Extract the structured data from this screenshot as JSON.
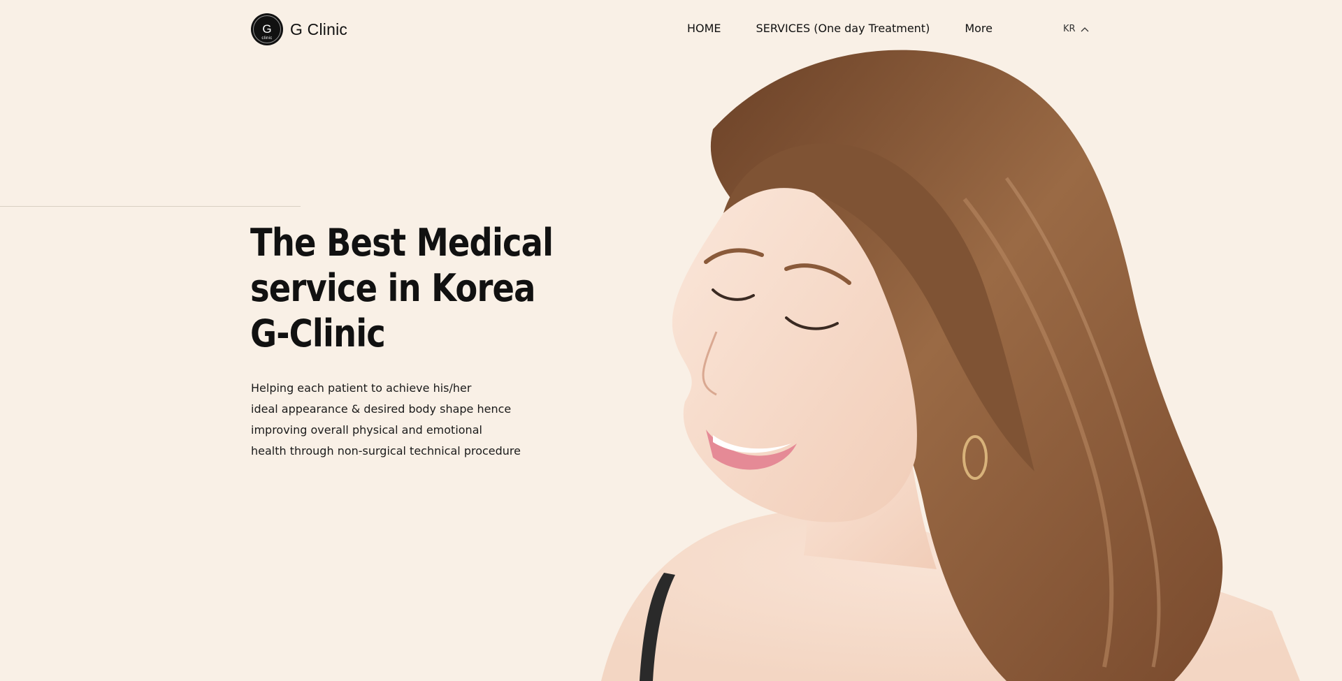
{
  "brand": {
    "name": "G Clinic",
    "badge_letter": "G",
    "badge_small_text": "clinic"
  },
  "nav": {
    "items": [
      {
        "label": "HOME"
      },
      {
        "label": "SERVICES (One day Treatment)"
      },
      {
        "label": "More"
      }
    ],
    "language": "KR"
  },
  "hero": {
    "title_lines": [
      "The Best Medical",
      "service in Korea",
      "G-Clinic"
    ],
    "description_lines": [
      "Helping each patient to achieve his/her",
      "ideal appearance & desired body shape hence",
      "improving overall physical and emotional",
      "health through non-surgical technical procedure"
    ]
  },
  "colors": {
    "background": "#f9f0e6",
    "text": "#111111",
    "hair": "#8a5a3a",
    "skin": "#f7dccb"
  },
  "icons": {
    "logo": "g-clinic-logo-icon",
    "language_toggle": "chevron-up-icon"
  }
}
